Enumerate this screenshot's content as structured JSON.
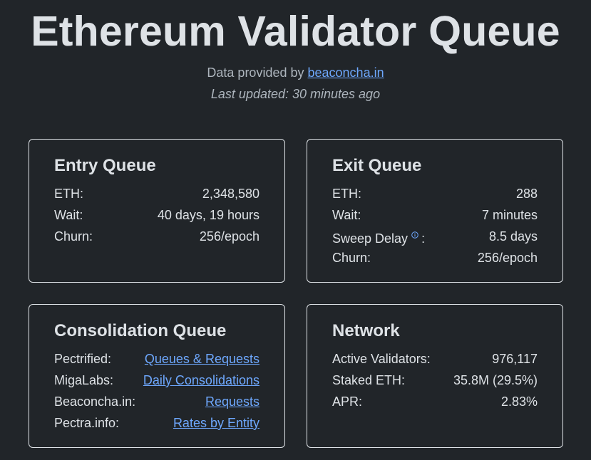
{
  "header": {
    "title": "Ethereum Validator Queue",
    "provided_prefix": "Data provided by ",
    "provided_link": "beaconcha.in",
    "last_updated": "Last updated: 30 minutes ago"
  },
  "colors": {
    "background": "#212529",
    "text": "#dee2e6",
    "muted": "#adb5bd",
    "link": "#6ea8fe",
    "border": "#dee2e6"
  },
  "entry_queue": {
    "title": "Entry Queue",
    "rows": [
      {
        "label": "ETH:",
        "value": "2,348,580"
      },
      {
        "label": "Wait:",
        "value": "40 days, 19 hours"
      },
      {
        "label": "Churn:",
        "value": "256/epoch"
      }
    ]
  },
  "exit_queue": {
    "title": "Exit Queue",
    "rows": [
      {
        "label": "ETH:",
        "value": "288"
      },
      {
        "label": "Wait:",
        "value": "7 minutes"
      },
      {
        "label": "Sweep Delay",
        "suffix": ":",
        "value": "8.5 days",
        "icon": "info-icon"
      },
      {
        "label": "Churn:",
        "value": "256/epoch"
      }
    ]
  },
  "consolidation_queue": {
    "title": "Consolidation Queue",
    "rows": [
      {
        "label": "Pectrified:",
        "link": "Queues & Requests"
      },
      {
        "label": "MigaLabs:",
        "link": "Daily Consolidations"
      },
      {
        "label": "Beaconcha.in:",
        "link": "Requests"
      },
      {
        "label": "Pectra.info:",
        "link": "Rates by Entity"
      }
    ]
  },
  "network": {
    "title": "Network",
    "rows": [
      {
        "label": "Active Validators:",
        "value": "976,117"
      },
      {
        "label": "Staked ETH:",
        "value": "35.8M (29.5%)"
      },
      {
        "label": "APR:",
        "value": "2.83%"
      }
    ]
  }
}
